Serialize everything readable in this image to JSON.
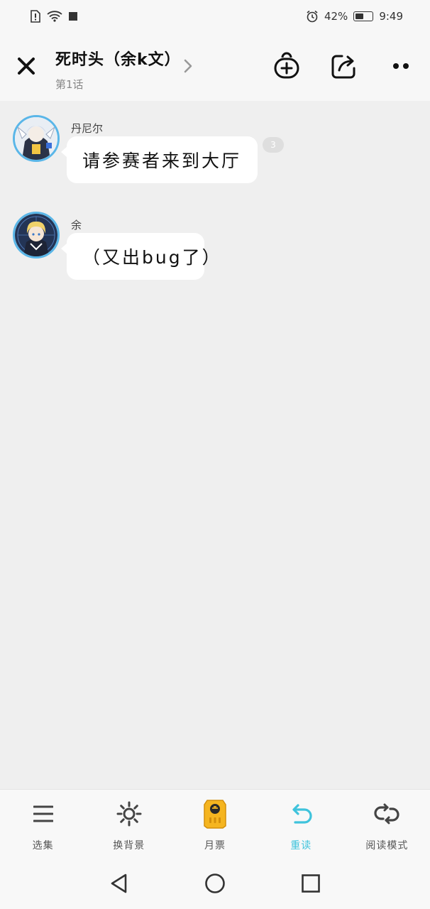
{
  "status_bar": {
    "battery": "42%",
    "time": "9:49"
  },
  "header": {
    "title": "死时头（余k文）",
    "subtitle": "第1话"
  },
  "messages": [
    {
      "sender": "丹尼尔",
      "text": "请参赛者来到大厅",
      "count": "3"
    },
    {
      "sender": "余",
      "text": "（又出bug了）"
    }
  ],
  "toolbar": {
    "items": [
      {
        "label": "选集",
        "icon": "menu-icon"
      },
      {
        "label": "换背景",
        "icon": "sun-icon"
      },
      {
        "label": "月票",
        "icon": "ticket-icon"
      },
      {
        "label": "重读",
        "icon": "replay-icon",
        "active": true
      },
      {
        "label": "阅读模式",
        "icon": "loop-icon"
      }
    ]
  },
  "colors": {
    "accent": "#3fc3dc",
    "avatar_ring": "#5ab6e8",
    "background": "#efefef"
  }
}
